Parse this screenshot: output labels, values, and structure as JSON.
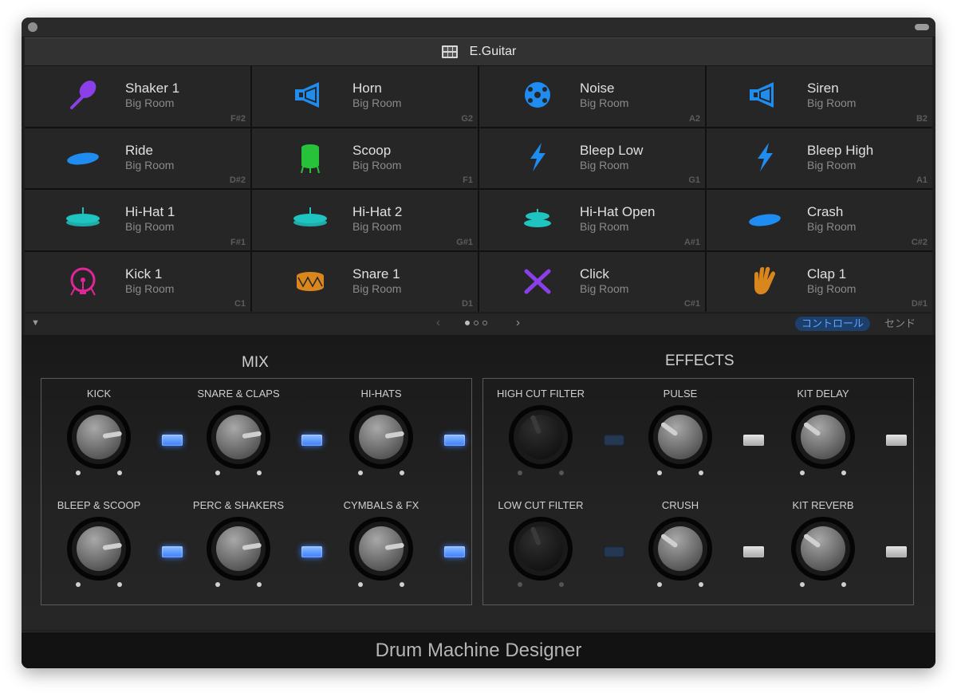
{
  "header": {
    "kit_name": "E.Guitar",
    "icon": "drum-kit-icon"
  },
  "pads": [
    {
      "name": "Shaker 1",
      "sub": "Big Room",
      "note": "F#2",
      "icon": "maraca-icon",
      "color": "#8a3fe8"
    },
    {
      "name": "Horn",
      "sub": "Big Room",
      "note": "G2",
      "icon": "horn-icon",
      "color": "#1e8cf0"
    },
    {
      "name": "Noise",
      "sub": "Big Room",
      "note": "A2",
      "icon": "noise-icon",
      "color": "#1e8cf0"
    },
    {
      "name": "Siren",
      "sub": "Big Room",
      "note": "B2",
      "icon": "siren-icon",
      "color": "#1e8cf0"
    },
    {
      "name": "Ride",
      "sub": "Big Room",
      "note": "D#2",
      "icon": "ride-cymbal-icon",
      "color": "#1e8cf0"
    },
    {
      "name": "Scoop",
      "sub": "Big Room",
      "note": "F1",
      "icon": "drum-icon",
      "color": "#27c23a"
    },
    {
      "name": "Bleep Low",
      "sub": "Big Room",
      "note": "G1",
      "icon": "lightning-icon",
      "color": "#1e8cf0"
    },
    {
      "name": "Bleep High",
      "sub": "Big Room",
      "note": "A1",
      "icon": "lightning-icon",
      "color": "#1e8cf0"
    },
    {
      "name": "Hi-Hat 1",
      "sub": "Big Room",
      "note": "F#1",
      "icon": "hihat-icon",
      "color": "#1fc4c0"
    },
    {
      "name": "Hi-Hat 2",
      "sub": "Big Room",
      "note": "G#1",
      "icon": "hihat-icon",
      "color": "#1fc4c0"
    },
    {
      "name": "Hi-Hat Open",
      "sub": "Big Room",
      "note": "A#1",
      "icon": "hihat-open-icon",
      "color": "#1fc4c0"
    },
    {
      "name": "Crash",
      "sub": "Big Room",
      "note": "C#2",
      "icon": "crash-cymbal-icon",
      "color": "#1e8cf0"
    },
    {
      "name": "Kick 1",
      "sub": "Big Room",
      "note": "C1",
      "icon": "kick-drum-icon",
      "color": "#e0259a"
    },
    {
      "name": "Snare 1",
      "sub": "Big Room",
      "note": "D1",
      "icon": "snare-drum-icon",
      "color": "#d9871c"
    },
    {
      "name": "Click",
      "sub": "Big Room",
      "note": "C#1",
      "icon": "drumsticks-icon",
      "color": "#8a3fe8"
    },
    {
      "name": "Clap 1",
      "sub": "Big Room",
      "note": "D#1",
      "icon": "hand-clap-icon",
      "color": "#d9871c"
    }
  ],
  "nav": {
    "prev": "‹",
    "next": "›",
    "pages": 3,
    "current_page": 1,
    "tab_control": "コントロール",
    "tab_send": "センド",
    "collapse_icon": "triangle-down-icon"
  },
  "mix": {
    "title": "MIX",
    "knobs": [
      {
        "label": "KICK",
        "value": 0.8,
        "enabled": true
      },
      {
        "label": "SNARE & CLAPS",
        "value": 0.8,
        "enabled": true
      },
      {
        "label": "HI-HATS",
        "value": 0.8,
        "enabled": true
      },
      {
        "label": "BLEEP & SCOOP",
        "value": 0.8,
        "enabled": true
      },
      {
        "label": "PERC & SHAKERS",
        "value": 0.8,
        "enabled": true
      },
      {
        "label": "CYMBALS & FX",
        "value": 0.8,
        "enabled": true
      }
    ]
  },
  "effects": {
    "title": "EFFECTS",
    "knobs": [
      {
        "label": "HIGH CUT FILTER",
        "value": 0.42,
        "enabled": false,
        "dim": true
      },
      {
        "label": "PULSE",
        "value": 0.3,
        "enabled": false,
        "dim": false
      },
      {
        "label": "KIT DELAY",
        "value": 0.3,
        "enabled": false,
        "dim": false
      },
      {
        "label": "LOW CUT FILTER",
        "value": 0.42,
        "enabled": false,
        "dim": true
      },
      {
        "label": "CRUSH",
        "value": 0.3,
        "enabled": false,
        "dim": false
      },
      {
        "label": "KIT REVERB",
        "value": 0.3,
        "enabled": false,
        "dim": false
      }
    ]
  },
  "footer": {
    "title": "Drum Machine Designer"
  },
  "colors": {
    "accent": "#3a7bff",
    "background": "#1f1f1f"
  }
}
